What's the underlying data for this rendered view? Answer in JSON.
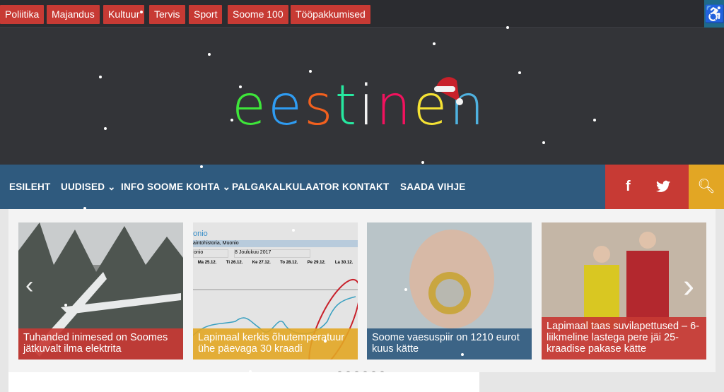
{
  "categories": [
    "Poliitika",
    "Majandus",
    "Kultuur",
    "Tervis",
    "Sport",
    "Soome 100",
    "Tööpakkumised"
  ],
  "accessibility_icon": "wheelchair-icon",
  "logo": {
    "letters": [
      "e",
      "e",
      "s",
      "t",
      "i",
      "n",
      "e",
      "n"
    ],
    "colors": [
      "#3ee63a",
      "#2f9cf2",
      "#f2601e",
      "#27e8a0",
      "#f2f2f2",
      "#f2125e",
      "#f5e234",
      "#4fb2e0"
    ]
  },
  "nav": {
    "items": [
      "ESILEHT",
      "UUDISED",
      "INFO SOOME KOHTA",
      "PALGAKALKULAATOR",
      "KONTAKT",
      "SAADA VIHJE"
    ],
    "facebook": "f",
    "twitter_icon": "twitter-icon",
    "search_icon": "search-icon"
  },
  "slider": {
    "cards": [
      {
        "caption": "Tuhanded inimesed on Soomes jätkuvalt ilma elektrita",
        "color": "#c73a34"
      },
      {
        "caption": "Lapimaal kerkis õhutemperatuur ühe päevaga 30 kraadi",
        "color": "#e2a624"
      },
      {
        "caption": "Soome vaesuspiir on 1210 eurot kuus kätte",
        "color": "#2f5a7e"
      },
      {
        "caption": "Lapimaal taas suvilapettused – 6-liikmeline lastega pere jäi 25-kraadise pakase kätte",
        "color": "#c73a34"
      }
    ],
    "chart_screenshot": {
      "title": "onio",
      "subtitle": "aintohistoria, Muonio",
      "field": "onio",
      "date": "8 Joulukuu 2017",
      "days": [
        "Ma 25.12.",
        "Ti 26.12.",
        "Ke 27.12.",
        "To 28.12.",
        "Pe 29.12.",
        "La 30.12."
      ]
    },
    "prev_icon": "chevron-left-icon",
    "next_icon": "chevron-right-icon"
  }
}
